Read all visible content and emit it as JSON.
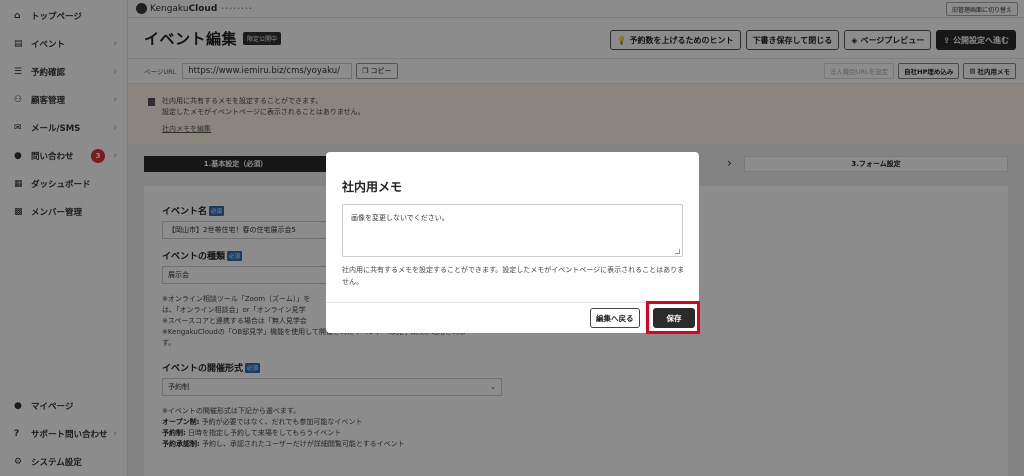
{
  "sidebar": {
    "items": [
      {
        "label": "トップページ",
        "icon": "home-icon",
        "chevron": false
      },
      {
        "label": "イベント",
        "icon": "document-icon",
        "chevron": true
      },
      {
        "label": "予約確認",
        "icon": "list-icon",
        "chevron": true
      },
      {
        "label": "顧客管理",
        "icon": "users-icon",
        "chevron": true
      },
      {
        "label": "メール/SMS",
        "icon": "mail-icon",
        "chevron": true
      },
      {
        "label": "問い合わせ",
        "icon": "chat-icon",
        "chevron": true,
        "badge": "3"
      },
      {
        "label": "ダッシュボード",
        "icon": "chart-icon",
        "chevron": false
      },
      {
        "label": "メンバー管理",
        "icon": "grid-icon",
        "chevron": false
      }
    ],
    "bottom_items": [
      {
        "label": "マイページ",
        "icon": "person-icon",
        "chevron": false
      },
      {
        "label": "サポート問い合わせ",
        "icon": "help-icon",
        "chevron": true
      },
      {
        "label": "システム設定",
        "icon": "gear-icon",
        "chevron": false
      }
    ]
  },
  "topbar": {
    "logo_prefix": "Kengaku",
    "logo_bold": "Cloud",
    "switch_label": "旧管理画面に切り替え"
  },
  "header": {
    "title": "イベント編集",
    "status": "限定公開中",
    "buttons": {
      "hint": "予約数を上げるためのヒント",
      "draft": "下書き保存して閉じる",
      "preview": "ページプレビュー",
      "publish": "公開設定へ進む"
    }
  },
  "urlbar": {
    "label": "ページURL",
    "url": "https://www.iemiru.biz/cms/yoyaku/",
    "copy": "コピー",
    "corp_url": "法人種別URLを設定",
    "embed": "自社HP埋め込み",
    "memo": "社内用メモ"
  },
  "memo_area": {
    "line1": "社内用に共有するメモを設定することができます。",
    "line2": "設定したメモがイベントページに表示されることはありません。",
    "edit_link": "社内メモを編集"
  },
  "steps": {
    "step1": "1.基本設定（必須）",
    "step3": "3.フォーム設定"
  },
  "form": {
    "event_name_label": "イベント名",
    "event_name_value": "【岡山市】2世帯住宅！春の住宅展示会5",
    "event_type_label": "イベントの種類",
    "event_type_value": "展示会",
    "required": "必須",
    "note1": "※オンライン相談ツール「Zoom（ズーム）」を",
    "note2": "は、「オンライン相談会」or「オンライン見学",
    "note3": "※スペースコアと連携する場合は「無人見学会",
    "note4": "※KengakuCloudの「OB邸見学」機能を使用して開催されたイベントへは見学保険が適用されま",
    "note5": "す。",
    "format_label": "イベントの開催形式",
    "format_value": "予約制",
    "format_note1": "※イベントの開催形式は下記から選べます。",
    "format_open_b": "オープン制:",
    "format_open": " 予約が必要ではなく、だれでも参加可能なイベント",
    "format_reserve_b": "予約制:",
    "format_reserve": " 日時を指定し予約して来場をしてもらうイベント",
    "format_approve_b": "予約承認制:",
    "format_approve": " 予約し、承認されたユーザーだけが詳細閲覧可能とするイベント"
  },
  "modal": {
    "title": "社内用メモ",
    "textarea_value": "画像を変更しないでください。",
    "help": "社内用に共有するメモを設定することができます。設定したメモがイベントページに表示されることはありません。",
    "back": "編集へ戻る",
    "save": "保存"
  },
  "colors": {
    "accent_dark": "#2b2b2b",
    "required_badge": "#2d6fb7",
    "highlight": "#e0001b",
    "notification_badge": "#d9363e"
  }
}
